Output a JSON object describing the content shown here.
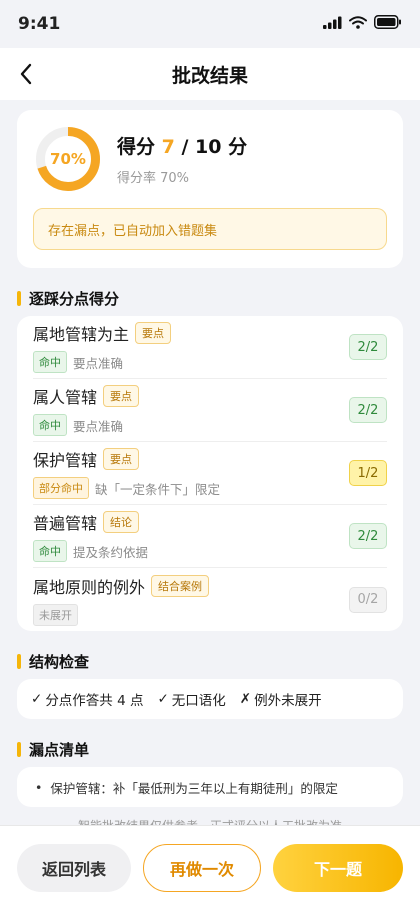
{
  "status_bar": {
    "time": "9:41"
  },
  "nav": {
    "title": "批改结果"
  },
  "score": {
    "ring_label": "70%",
    "ring_fraction": 0.7,
    "prefix": "得分 ",
    "earned": "7",
    "separator": " / ",
    "total": "10 分",
    "rate_text": "得分率 70%",
    "notice": "存在漏点，已自动加入错题集"
  },
  "points_section": {
    "title": "逐踩分点得分",
    "items": [
      {
        "name": "属地管辖为主",
        "tag": "要点",
        "status": "命中",
        "status_type": "hit",
        "comment": "要点准确",
        "score": "2/2",
        "score_type": "full"
      },
      {
        "name": "属人管辖",
        "tag": "要点",
        "status": "命中",
        "status_type": "hit",
        "comment": "要点准确",
        "score": "2/2",
        "score_type": "full"
      },
      {
        "name": "保护管辖",
        "tag": "要点",
        "status": "部分命中",
        "status_type": "partial",
        "comment": "缺「一定条件下」限定",
        "score": "1/2",
        "score_type": "partial"
      },
      {
        "name": "普遍管辖",
        "tag": "结论",
        "status": "命中",
        "status_type": "hit",
        "comment": "提及条约依据",
        "score": "2/2",
        "score_type": "full"
      },
      {
        "name": "属地原则的例外",
        "tag": "结合案例",
        "status": "未展开",
        "status_type": "none",
        "comment": "",
        "score": "0/2",
        "score_type": "zero"
      }
    ]
  },
  "structure_section": {
    "title": "结构检查",
    "checks": [
      {
        "mark": "✓",
        "text": "分点作答共 4 点"
      },
      {
        "mark": "✓",
        "text": "无口语化"
      },
      {
        "mark": "✗",
        "text": "例外未展开"
      }
    ]
  },
  "missing_section": {
    "title": "漏点清单",
    "items": [
      {
        "bullet": "•",
        "text": "保护管辖：补「最低刑为三年以上有期徒刑」的限定"
      }
    ]
  },
  "disclaimer": "智能批改结果仅供参考，正式评分以人工批改为准",
  "buttons": {
    "back": "返回列表",
    "redo": "再做一次",
    "next": "下一题"
  },
  "colors": {
    "accent": "#f5a623",
    "hit": "#2f8a3c",
    "partial": "#c98a12"
  },
  "icons": {
    "back": "chevron-left-icon",
    "signal": "signal-icon",
    "wifi": "wifi-icon",
    "battery": "battery-icon"
  }
}
